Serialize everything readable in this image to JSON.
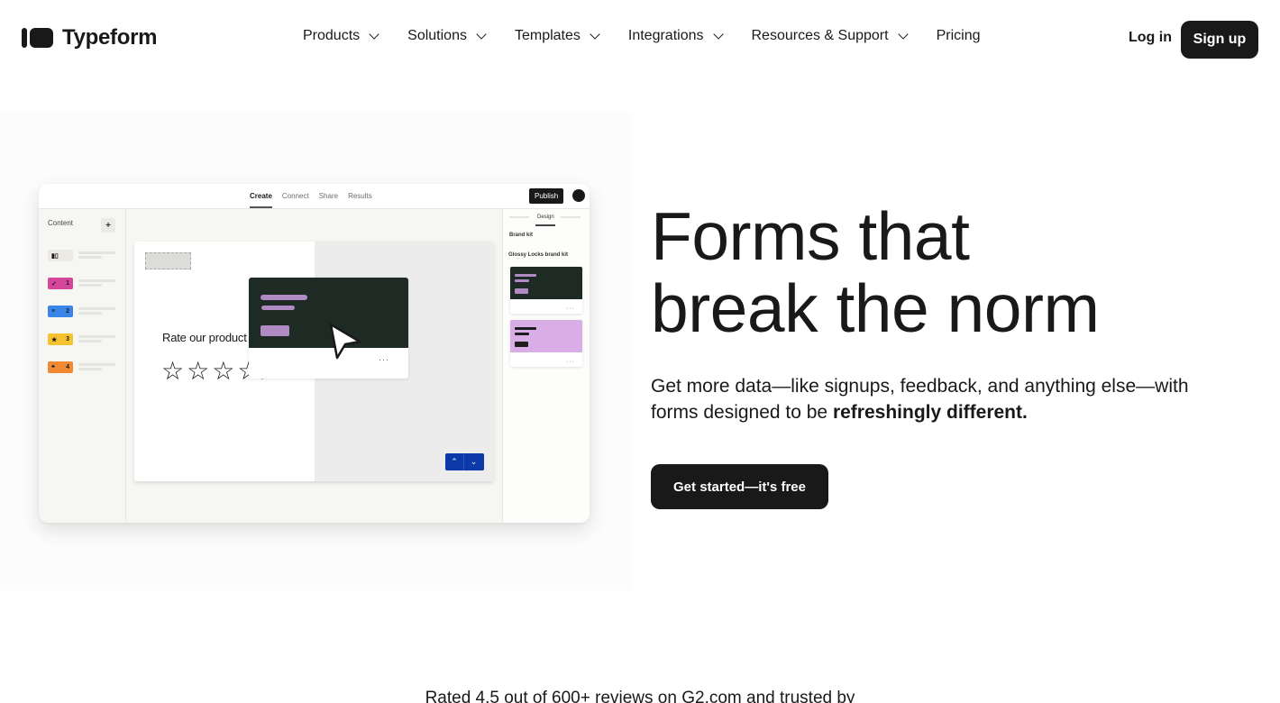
{
  "nav": {
    "logo_text": "Typeform",
    "menu": [
      {
        "label": "Products",
        "has_dropdown": true
      },
      {
        "label": "Solutions",
        "has_dropdown": true
      },
      {
        "label": "Templates",
        "has_dropdown": true
      },
      {
        "label": "Integrations",
        "has_dropdown": true
      },
      {
        "label": "Resources & Support",
        "has_dropdown": true
      },
      {
        "label": "Pricing",
        "has_dropdown": false
      }
    ],
    "login_label": "Log in",
    "signup_label": "Sign up"
  },
  "preview": {
    "tabs": [
      "Create",
      "Connect",
      "Share",
      "Results"
    ],
    "active_tab": "Create",
    "publish_label": "Publish",
    "content_label": "Content",
    "add_label": "+",
    "questions": [
      {
        "icon": "welcome-screen-icon",
        "glyph": "▮▯",
        "number": "",
        "color": "#ece8e3"
      },
      {
        "icon": "checkmark-icon",
        "glyph": "✓",
        "number": "1",
        "color": "#d6479b"
      },
      {
        "icon": "short-text-icon",
        "glyph": "≡",
        "number": "2",
        "color": "#3a86e8"
      },
      {
        "icon": "star-icon",
        "glyph": "★",
        "number": "3",
        "color": "#f6c230"
      },
      {
        "icon": "quote-icon",
        "glyph": "❝",
        "number": "4",
        "color": "#f08a35"
      }
    ],
    "question_text": "Rate our product",
    "stars_shown": 5,
    "design_tab": "Design",
    "brand_kit_label": "Brand kit",
    "kit_name": "Glossy Locks brand kit",
    "kits": [
      {
        "bg": "#1e2b24",
        "accent": "#b08ac3"
      },
      {
        "bg": "#d9aee6",
        "accent": "#1e1e1e"
      }
    ],
    "more_glyph": "···",
    "arrow_up": "⌃",
    "arrow_down": "⌄"
  },
  "hero": {
    "headline_line1": "Forms that",
    "headline_line2": "break the norm",
    "subtext_plain": "Get more data—like signups, feedback, and anything else—with forms designed to be ",
    "subtext_bold": "refreshingly different.",
    "cta_label": "Get started—it's free"
  },
  "social_proof": {
    "text": "Rated 4.5 out of 600+ reviews on G2.com and trusted by"
  }
}
